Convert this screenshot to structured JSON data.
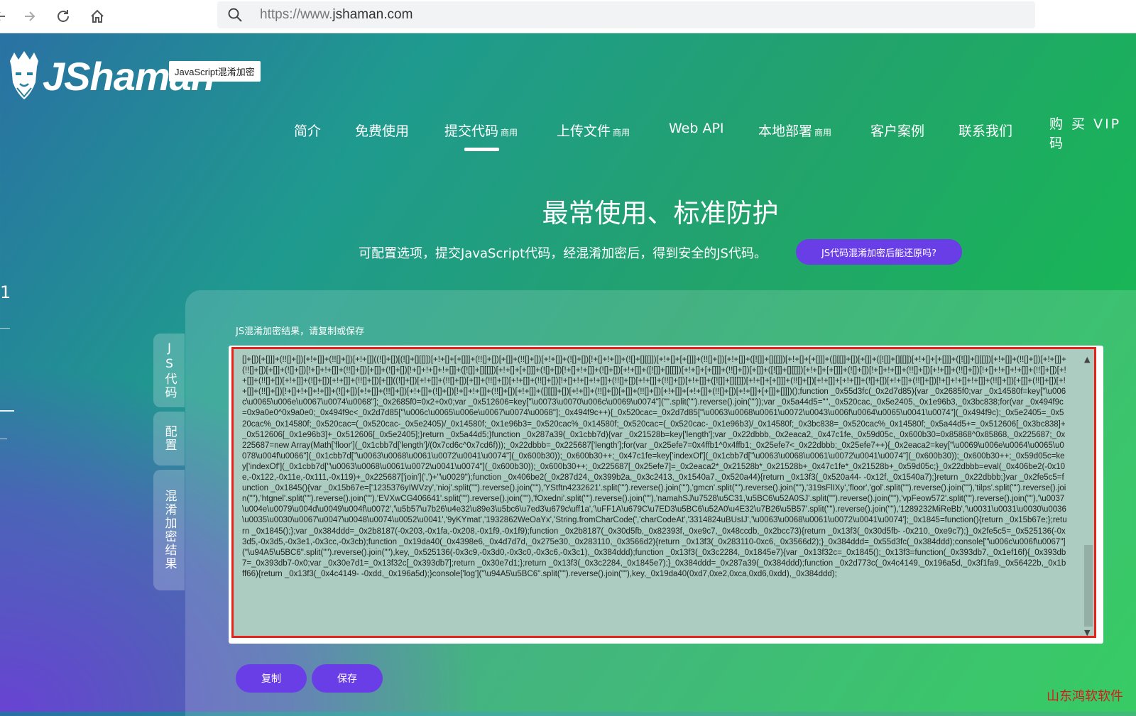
{
  "browser": {
    "url_prefix": "https://www.",
    "url_domain": "jshaman.com"
  },
  "logo": {
    "text": "JShaman",
    "tagline": "JavaScript混淆加密"
  },
  "nav": {
    "items": [
      {
        "label": "简介",
        "badge": ""
      },
      {
        "label": "免费使用",
        "badge": ""
      },
      {
        "label": "提交代码",
        "badge": "商用"
      },
      {
        "label": "上传文件",
        "badge": "商用"
      },
      {
        "label": "Web API",
        "badge": ""
      },
      {
        "label": "本地部署",
        "badge": "商用"
      },
      {
        "label": "客户案例",
        "badge": ""
      },
      {
        "label": "联系我们",
        "badge": ""
      }
    ],
    "active_index": 2,
    "vip": "购 买 VIP 码"
  },
  "hero": {
    "title": "最常使用、标准防护",
    "subtitle": "可配置选项，提交JavaScript代码，经混淆加密后，得到安全的JS代码。",
    "pill": "JS代码混淆加密后能还原吗?"
  },
  "left_edge": {
    "char": "1"
  },
  "side_tabs": [
    "JS代码",
    "配置",
    "混淆加密结果"
  ],
  "result": {
    "label": "JS混淆加密结果，请复制或保存",
    "code": "[]+[])[+[]]]+(!![]+[])[+!+[]]+(!![]+[])[+!+[]]((![]+[])[(![]+[][[]])[+!+[]+[+[]]]+(!![]+[])[+[]]+(!![]+[])[+!+[]]+(![]+[])[!+[]+!+[]]+(![]+[][[]])[+!+[]+[+[]]]+(!![]+[])[+!+[]]+([![]]+[][[]])[+!+[]+[+[]]]+([][[]]+[])[+[]]+([![]]+[][[]])[+!+[]+[+[]]]+([![]]+[][[]])[+!+[]]+(!![]+[])[+!+[]]+(!![]+[])[+[]]+(![]+[])[!+[]+!+[]]+(!![]+[])[+[]]+(![]+[])[!+[]+!+[]+!+[]]+([![]]+[][[]])[+!+[]+[+[]]]+(![]+[])[!+[]+!+[]]+(![]+[])[+!+[]]+([![]]+[][[]])[+!+[]+[+[]]]+(!![]+[])[+[]]+([![]]+[][[]])[+!+[]+[+[]]]+(![]+[])[!+[]+!+[]]+(!![]+[])[+!+[]]+(!![]+[])[!+[]+!+[]+!+[]]+(!![]+[])[+!+[]]+(!![]+[])[+!+[]]+(![]+[])[+!+[]]+(!![]+[])[+[]]((![]+[])[+!+[]]+(!![]+[])[+[]]+(!![]+[])[+!+[]]+(!![]+[])[!+[]+!+[]+!+[]]+(!![]+[])[+!+[]]+(!![]+[])[+!+[]]+([![]]+[][[]])[+!+[]+[+[]]]+(!![]+[])[+!+[]]+[+!+[]]+(![]+[])[+!+[]]+(!![]+[])[!+[]+!+[]+!+[]]+(!![]+[])[+[]]+(!![]+[])[+!+[]]+(!![]+[])[!+[]+!+[]+!+[]]+(![]+[])[+!+[]]+(!![]+[])[+!+[]]+(![]+[])[!+[]+!+[]]+(!![]+[])[+!+[]]+([][[]]+[])[+!+[]]+(!![]+[])[+[]]+(!![]+[])[+!+[]]+[+!+[]]+(!![]+[])[+!+[]]+[+[]]+[]]])();function _0x55d3fc(_0x2d7d85){var _0x2685f0;var _0x14580f=key[\"\\u006c\\u0065\\u006e\\u0067\\u0074\\u0068\"];_0x2685f0=0x2+0x0;var _0x512606=key[\"\\u0073\\u0070\\u006c\\u0069\\u0074\"](\"\".split(\"\").reverse().join(\"\"));var _0x5a44d5=\"\",_0x520cac,_0x5e2405,_0x1e96b3,_0x3bc838;for(var _0x494f9c=0x9a0e0^0x9a0e0;_0x494f9c<_0x2d7d85[\"\\u006c\\u0065\\u006e\\u0067\\u0074\\u0068\"];_0x494f9c++){_0x520cac=_0x2d7d85[\"\\u0063\\u0068\\u0061\\u0072\\u0043\\u006f\\u0064\\u0065\\u0041\\u0074\"](_0x494f9c);_0x5e2405=_0x520cac%_0x14580f;_0x520cac=(_0x520cac-_0x5e2405)/_0x14580f;_0x1e96b3=_0x520cac%_0x14580f;_0x520cac=(_0x520cac-_0x1e96b3)/_0x14580f;_0x3bc838=_0x520cac%_0x14580f;_0x5a44d5+=_0x512606[_0x3bc838]+_0x512606[_0x1e96b3]+_0x512606[_0x5e2405];}return _0x5a44d5;}function _0x287a39(_0x1cbb7d){var _0x21528b=key['length'];var _0x22dbbb,_0x2eaca2,_0x47c1fe,_0x59d05c,_0x600b30=0x85868^0x85868,_0x225687;_0x225687=new Array(Math['floor'](_0x1cbb7d['length']/(0x7cd6c^0x7cd6f)));_0x22dbbb=_0x225687['length'];for(var _0x25efe7=0x4ffb1^0x4ffb1;_0x25efe7<_0x22dbbb;_0x25efe7++){_0x2eaca2=key[\"\\u0069\\u006e\\u0064\\u0065\\u0078\\u004f\\u0066\"](_0x1cbb7d[\"\\u0063\\u0068\\u0061\\u0072\\u0041\\u0074\"](_0x600b30));_0x600b30++;_0x47c1fe=key['indexOf'](_0x1cbb7d[\"\\u0063\\u0068\\u0061\\u0072\\u0041\\u0074\"](_0x600b30));_0x600b30++;_0x59d05c=key['indexOf'](_0x1cbb7d[\"\\u0063\\u0068\\u0061\\u0072\\u0041\\u0074\"](_0x600b30));_0x600b30++;_0x225687[_0x25efe7]=_0x2eaca2*_0x21528b*_0x21528b+_0x47c1fe*_0x21528b+_0x59d05c;}_0x22dbbb=eval(_0x406be2(-0x10e,-0x122,-0x11e,-0x111,-0x119)+_0x225687['join'](',')+\"\\u0029\");function _0x406be2(_0x287d24,_0x399b2a,_0x3c2413,_0x1540a7,_0x520a44){return _0x13f3(_0x520a44- -0x12f,_0x1540a7);}return _0x22dbbb;}var _0x2fe5c5=function _0x1845(){var _0x15b67e=['1235376yIWVzy','nioj'.split(\"\").reverse().join(\"\"),'YStftn4232621'.split(\"\").reverse().join(\"\"),'gmcn'.split(\"\").reverse().join(\"\"),'319sFlIXy','floor','gol'.split(\"\").reverse().join(\"\"),'tilps'.split(\"\").reverse().join(\"\"),'htgnel'.split(\"\").reverse().join(\"\"),'EVXwCG406641'.split(\"\").reverse().join(\"\"),'fOxedni'.split(\"\").reverse().join(\"\"),'namahSJ\\u7528\\u5C31,\\u5BC6\\u52A0SJ'.split(\"\").reverse().join(\"\"),'vpFeow572'.split(\"\").reverse().join(\"\"),'\\u0037\\u004e\\u0079\\u004d\\u0049\\u004f\\u0072','\\u5b57\\u7b26\\u4e32\\u89e3\\u5bc6\\u7ed3\\u679c\\uff1a','\\uFF1A\\u679C\\u7ED3\\u5BC6\\u52A0\\u4E32\\u7B26\\u5B57'.split(\"\").reverse().join(\"\"),'1289232MiReBb','\\u0031\\u0031\\u0030\\u0036\\u0035\\u0030\\u0067\\u0047\\u0048\\u0074\\u0052\\u0041','9yKYmat','1932862WeOaYx','String.fromCharCode(','charCodeAt','3314824uBUsIJ','\\u0063\\u0068\\u0061\\u0072\\u0041\\u0074'];_0x1845=function(){return _0x15b67e;};return _0x1845();};var _0x384ddd=_0x2b8187(-0x203,-0x1fa,-0x208,-0x1f9,-0x1f9);function _0x2b8187(_0x30d5fb,_0x82393f,_0xe9c7,_0x48ccdb,_0x2bcc73){return _0x13f3(_0x30d5fb- -0x210,_0xe9c7);}_0x2fe5c5=_0x525136(-0x3d5,-0x3d5,-0x3e1,-0x3cc,-0x3cb);function _0x19da40(_0x4398e6,_0x4d7d7d,_0x275e30,_0x283110,_0x3566d2){return _0x13f3(_0x283110-0xc6,_0x3566d2);}_0x384ddd=_0x55d3fc(_0x384ddd);console[\"\\u006c\\u006f\\u0067\"](\"\\u94A5\\u5BC6\".split(\"\").reverse().join(\"\"),key,_0x525136(-0x3c9,-0x3d0,-0x3c0,-0x3c6,-0x3c1),_0x384ddd);function _0x13f3(_0x3c2284,_0x1845e7){var _0x13f32c=_0x1845();_0x13f3=function(_0x393db7,_0x1ef16f){_0x393db7=_0x393db7-0x0;var _0x30e7d1=_0x13f32c[_0x393db7];return _0x30e7d1;};return _0x13f3(_0x3c2284,_0x1845e7);}_0x384ddd=_0x287a39(_0x384ddd);function _0x2d773c(_0x4c4149,_0x196a5d,_0x3f1fa9,_0x56422b,_0x1bff66){return _0x13f3(_0x4c4149- -0xdd,_0x196a5d);}console['log'](\"\\u94A5\\u5BC6\".split(\"\").reverse().join(\"\"),key,_0x19da40(0xd7,0xe2,0xca,0xd6,0xdd),_0x384ddd);"
  },
  "buttons": {
    "copy": "复制",
    "save": "保存"
  },
  "watermark": "山东鸿软软件"
}
